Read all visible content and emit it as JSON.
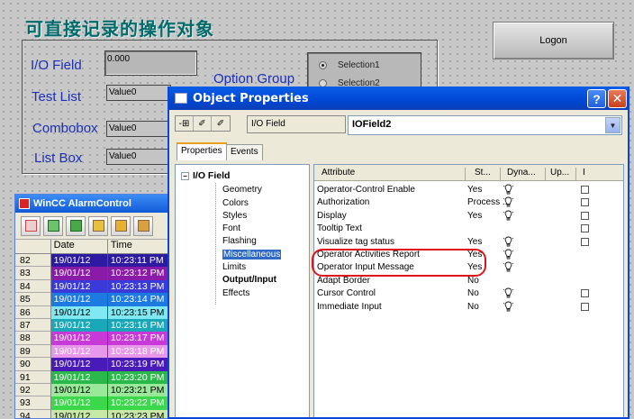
{
  "header": {
    "title_cn": "可直接记录的操作对象"
  },
  "logon": {
    "label": "Logon"
  },
  "form": {
    "io_field": {
      "label": "I/O Field",
      "value": "0.000"
    },
    "test_list": {
      "label": "Test List",
      "value": "Value0"
    },
    "combobox": {
      "label": "Combobox",
      "value": "Value0"
    },
    "list_box": {
      "label": "List Box",
      "value": "Value0"
    },
    "option_group": {
      "label": "Option Group",
      "options": [
        "Selection1",
        "Selection2"
      ]
    }
  },
  "alarm": {
    "title": "WinCC AlarmControl",
    "columns": {
      "date": "Date",
      "time": "Time"
    },
    "rows": [
      {
        "num": "82",
        "date": "19/01/12",
        "time": "10:23:11 PM",
        "bg": "#2c1aa0",
        "fg": "#ffffff"
      },
      {
        "num": "83",
        "date": "19/01/12",
        "time": "10:23:12 PM",
        "bg": "#8a1aa8",
        "fg": "#ffffff"
      },
      {
        "num": "84",
        "date": "19/01/12",
        "time": "10:23:13 PM",
        "bg": "#3a3ad8",
        "fg": "#ffffff"
      },
      {
        "num": "85",
        "date": "19/01/12",
        "time": "10:23:14 PM",
        "bg": "#1d7ae0",
        "fg": "#ffffff"
      },
      {
        "num": "86",
        "date": "19/01/12",
        "time": "10:23:15 PM",
        "bg": "#7fe8f0",
        "fg": "#000000"
      },
      {
        "num": "87",
        "date": "19/01/12",
        "time": "10:23:16 PM",
        "bg": "#1aa8b8",
        "fg": "#ffffff"
      },
      {
        "num": "88",
        "date": "19/01/12",
        "time": "10:23:17 PM",
        "bg": "#c83ad8",
        "fg": "#ffffff"
      },
      {
        "num": "89",
        "date": "19/01/12",
        "time": "10:23:18 PM",
        "bg": "#e898e8",
        "fg": "#ffffff"
      },
      {
        "num": "90",
        "date": "19/01/12",
        "time": "10:23:19 PM",
        "bg": "#4a1ab8",
        "fg": "#ffffff"
      },
      {
        "num": "91",
        "date": "19/01/12",
        "time": "10:23:20 PM",
        "bg": "#2ab84a",
        "fg": "#ffffff"
      },
      {
        "num": "92",
        "date": "19/01/12",
        "time": "10:23:21 PM",
        "bg": "#9ae89a",
        "fg": "#000000"
      },
      {
        "num": "93",
        "date": "19/01/12",
        "time": "10:23:22 PM",
        "bg": "#3ad84a",
        "fg": "#ffffff"
      },
      {
        "num": "94",
        "date": "19/01/12",
        "time": "10:23:23 PM",
        "bg": "#c8e8a8",
        "fg": "#000000"
      }
    ]
  },
  "dialog": {
    "title": "Object Properties",
    "help_label": "?",
    "close_label": "✕",
    "object_type": "I/O Field",
    "object_name": "IOField2",
    "tabs": [
      "Properties",
      "Events"
    ],
    "tree": {
      "root": "I/O Field",
      "items": [
        "Geometry",
        "Colors",
        "Styles",
        "Font",
        "Flashing",
        "Miscellaneous",
        "Limits",
        "Output/Input",
        "Effects"
      ]
    },
    "columns": [
      "Attribute",
      "St...",
      "Dyna...",
      "Up...",
      "I"
    ],
    "attributes": [
      {
        "name": "Operator-Control Enable",
        "static": "Yes",
        "dynamic": true,
        "indirect": true
      },
      {
        "name": "Authorization",
        "static": "Process ...",
        "dynamic": true,
        "indirect": true
      },
      {
        "name": "Display",
        "static": "Yes",
        "dynamic": true,
        "indirect": true
      },
      {
        "name": "Tooltip Text",
        "static": "",
        "dynamic": false,
        "indirect": true
      },
      {
        "name": "Visualize tag status",
        "static": "Yes",
        "dynamic": true,
        "indirect": true
      },
      {
        "name": "Operator Activities Report",
        "static": "Yes",
        "dynamic": true,
        "indirect": false
      },
      {
        "name": "Operator Input Message",
        "static": "Yes",
        "dynamic": true,
        "indirect": false
      },
      {
        "name": "Adapt Border",
        "static": "No",
        "dynamic": false,
        "indirect": false
      },
      {
        "name": "Cursor Control",
        "static": "No",
        "dynamic": true,
        "indirect": true
      },
      {
        "name": "Immediate Input",
        "static": "No",
        "dynamic": true,
        "indirect": true
      }
    ]
  },
  "colors": {
    "label_blue": "#1c2fb8",
    "title_teal": "#006b6b",
    "highlight_red": "#e0141a",
    "xp_blue": "#0a46d8"
  }
}
